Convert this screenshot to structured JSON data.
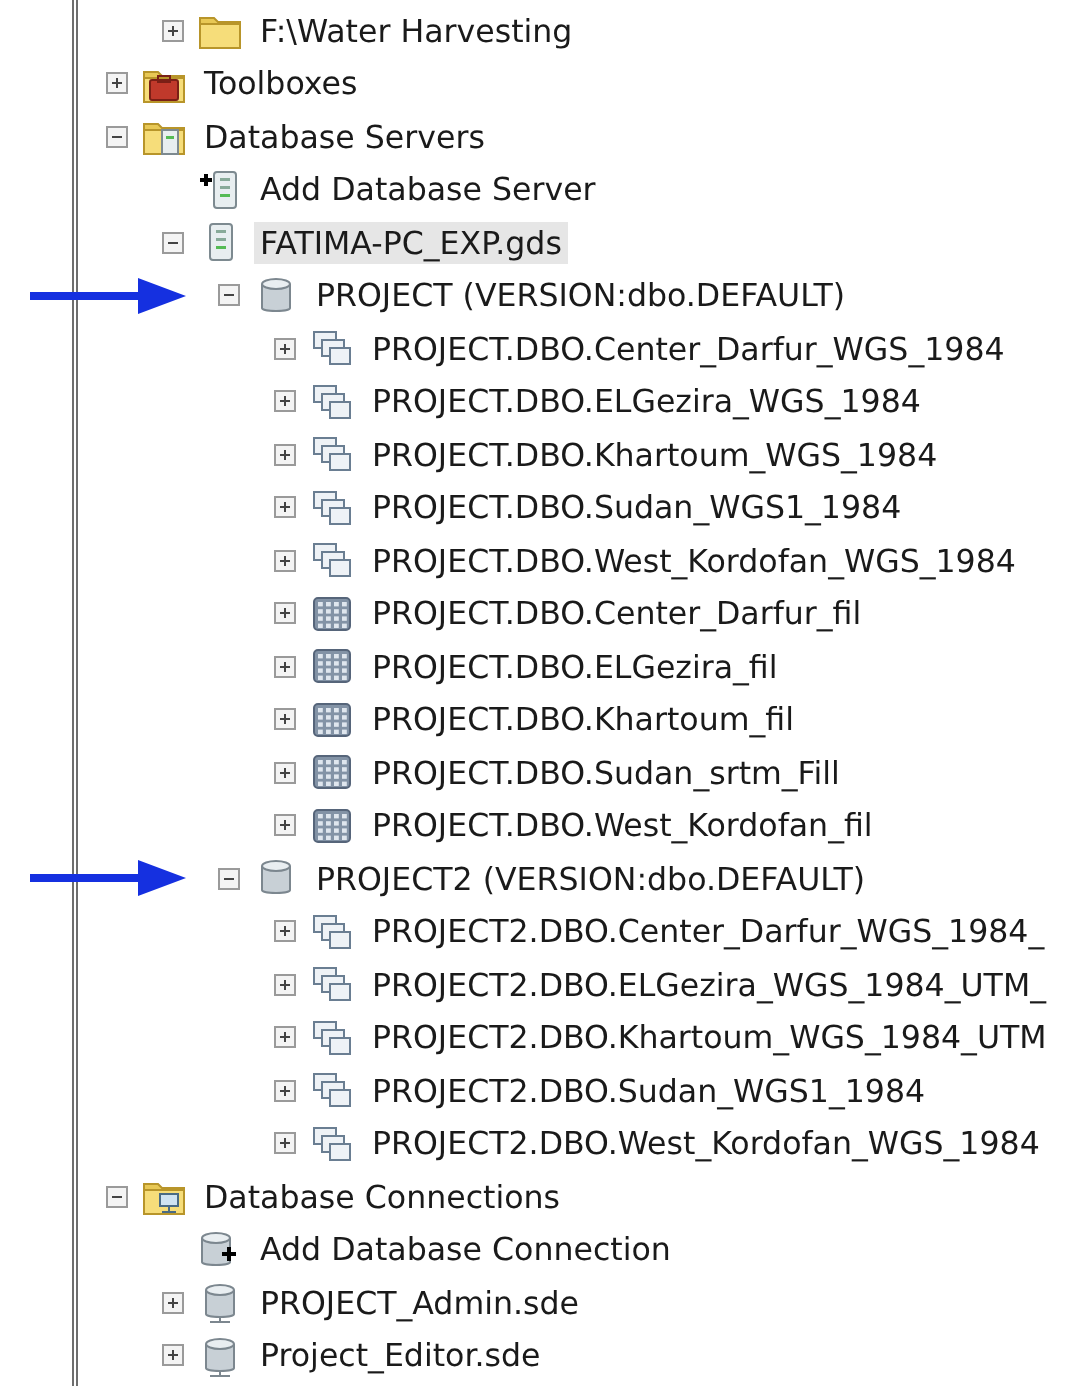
{
  "tree": {
    "continued": [
      {
        "label": "F:\\Water Harvesting",
        "kind": "folder",
        "expanded": false,
        "selected": false,
        "arrow": false
      }
    ],
    "items": [
      {
        "label": "Toolboxes",
        "kind": "toolbox",
        "expanded": false,
        "selected": false,
        "arrow": false
      },
      {
        "label": "Database Servers",
        "kind": "server-folder",
        "expanded": true,
        "selected": false,
        "arrow": false,
        "children": [
          {
            "label": "Add Database Server",
            "kind": "add-server",
            "selected": false,
            "arrow": false
          },
          {
            "label": "FATIMA-PC_EXP.gds",
            "kind": "server",
            "expanded": true,
            "selected": true,
            "arrow": false,
            "children": [
              {
                "label": "PROJECT (VERSION:dbo.DEFAULT)",
                "kind": "database",
                "expanded": true,
                "selected": false,
                "arrow": true,
                "children": [
                  {
                    "label": "PROJECT.DBO.Center_Darfur_WGS_1984",
                    "kind": "dataset",
                    "expanded": false,
                    "selected": false,
                    "arrow": false
                  },
                  {
                    "label": "PROJECT.DBO.ELGezira_WGS_1984",
                    "kind": "dataset",
                    "expanded": false,
                    "selected": false,
                    "arrow": false
                  },
                  {
                    "label": "PROJECT.DBO.Khartoum_WGS_1984",
                    "kind": "dataset",
                    "expanded": false,
                    "selected": false,
                    "arrow": false
                  },
                  {
                    "label": "PROJECT.DBO.Sudan_WGS1_1984",
                    "kind": "dataset",
                    "expanded": false,
                    "selected": false,
                    "arrow": false
                  },
                  {
                    "label": "PROJECT.DBO.West_Kordofan_WGS_1984",
                    "kind": "dataset",
                    "expanded": false,
                    "selected": false,
                    "arrow": false
                  },
                  {
                    "label": "PROJECT.DBO.Center_Darfur_fil",
                    "kind": "raster",
                    "expanded": false,
                    "selected": false,
                    "arrow": false
                  },
                  {
                    "label": "PROJECT.DBO.ELGezira_fil",
                    "kind": "raster",
                    "expanded": false,
                    "selected": false,
                    "arrow": false
                  },
                  {
                    "label": "PROJECT.DBO.Khartoum_fil",
                    "kind": "raster",
                    "expanded": false,
                    "selected": false,
                    "arrow": false
                  },
                  {
                    "label": "PROJECT.DBO.Sudan_srtm_Fill",
                    "kind": "raster",
                    "expanded": false,
                    "selected": false,
                    "arrow": false
                  },
                  {
                    "label": "PROJECT.DBO.West_Kordofan_fil",
                    "kind": "raster",
                    "expanded": false,
                    "selected": false,
                    "arrow": false
                  }
                ]
              },
              {
                "label": "PROJECT2 (VERSION:dbo.DEFAULT)",
                "kind": "database",
                "expanded": true,
                "selected": false,
                "arrow": true,
                "children": [
                  {
                    "label": "PROJECT2.DBO.Center_Darfur_WGS_1984_",
                    "kind": "dataset",
                    "expanded": false,
                    "selected": false,
                    "arrow": false
                  },
                  {
                    "label": "PROJECT2.DBO.ELGezira_WGS_1984_UTM_",
                    "kind": "dataset",
                    "expanded": false,
                    "selected": false,
                    "arrow": false
                  },
                  {
                    "label": "PROJECT2.DBO.Khartoum_WGS_1984_UTM",
                    "kind": "dataset",
                    "expanded": false,
                    "selected": false,
                    "arrow": false
                  },
                  {
                    "label": "PROJECT2.DBO.Sudan_WGS1_1984",
                    "kind": "dataset",
                    "expanded": false,
                    "selected": false,
                    "arrow": false
                  },
                  {
                    "label": "PROJECT2.DBO.West_Kordofan_WGS_1984",
                    "kind": "dataset",
                    "expanded": false,
                    "selected": false,
                    "arrow": false
                  }
                ]
              }
            ]
          }
        ]
      },
      {
        "label": "Database Connections",
        "kind": "connection-folder",
        "expanded": true,
        "selected": false,
        "arrow": false,
        "children": [
          {
            "label": "Add Database Connection",
            "kind": "add-connection",
            "selected": false,
            "arrow": false
          },
          {
            "label": "PROJECT_Admin.sde",
            "kind": "connection",
            "expanded": false,
            "selected": false,
            "arrow": false
          },
          {
            "label": "Project_Editor.sde",
            "kind": "connection",
            "expanded": false,
            "selected": false,
            "arrow": false
          }
        ]
      }
    ]
  }
}
